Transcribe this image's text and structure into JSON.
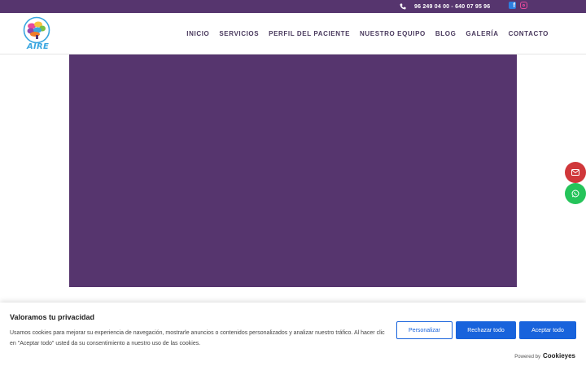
{
  "topbar": {
    "phone": "96 249 04 00 - 640 07 95 96",
    "icons": [
      "phone-icon",
      "facebook-icon",
      "instagram-icon"
    ]
  },
  "header": {
    "logo_text": "AIRE",
    "nav": [
      "INICIO",
      "SERVICIOS",
      "PERFIL DEL PACIENTE",
      "NUESTRO EQUIPO",
      "BLOG",
      "GALERÍA",
      "CONTACTO"
    ]
  },
  "colors": {
    "brand_purple": "#56356e",
    "accent_blue": "#1863dc",
    "mail_red": "#d0373a",
    "whatsapp_green": "#25c45a"
  },
  "floating": {
    "icons": [
      "mail-icon",
      "whatsapp-icon"
    ]
  },
  "cookie": {
    "title": "Valoramos tu privacidad",
    "text": "Usamos cookies para mejorar su experiencia de navegación, mostrarle anuncios o contenidos personalizados y analizar nuestro tráfico. Al hacer clic en \"Aceptar todo\" usted da su consentimiento a nuestro uso de las cookies.",
    "customize": "Personalizar",
    "reject": "Rechazar todo",
    "accept": "Aceptar todo",
    "powered_by": "Powered by",
    "brand": "Cookieyes"
  }
}
